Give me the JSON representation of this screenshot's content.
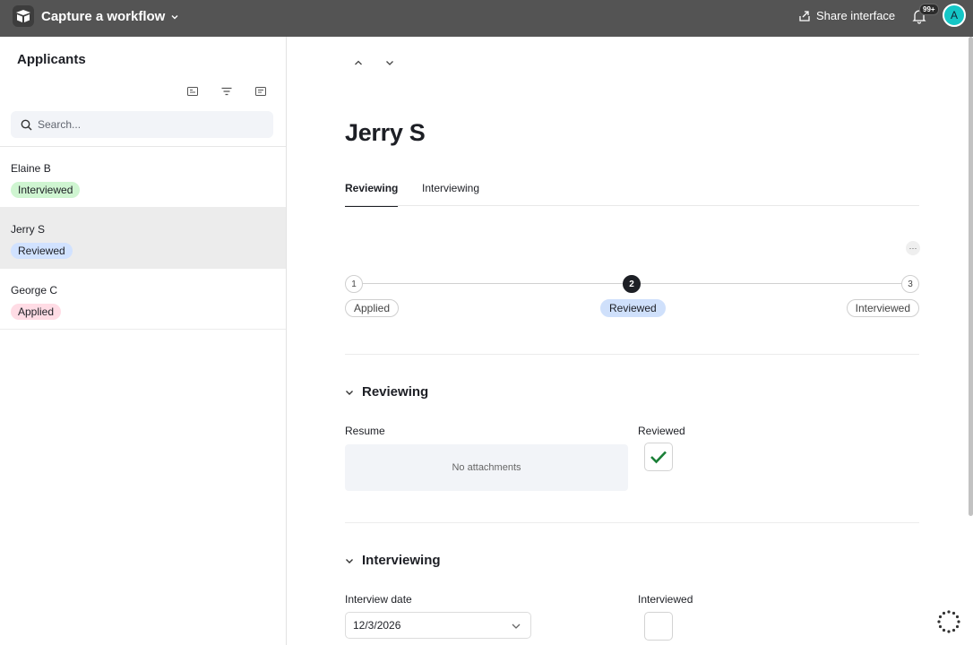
{
  "topbar": {
    "app_title": "Capture a workflow",
    "share_label": "Share interface",
    "notification_count": "99+",
    "avatar_initial": "A"
  },
  "sidebar": {
    "title": "Applicants",
    "search_placeholder": "Search...",
    "items": [
      {
        "name": "Elaine B",
        "status": "Interviewed",
        "status_color": "#cff5d1",
        "selected": false
      },
      {
        "name": "Jerry S",
        "status": "Reviewed",
        "status_color": "#d1e2ff",
        "selected": true
      },
      {
        "name": "George C",
        "status": "Applied",
        "status_color": "#ffdce5",
        "selected": false
      }
    ]
  },
  "record": {
    "title": "Jerry S",
    "tabs": [
      {
        "label": "Reviewing",
        "active": true
      },
      {
        "label": "Interviewing",
        "active": false
      }
    ],
    "more_label": "···",
    "steps": [
      {
        "number": "1",
        "label": "Applied",
        "active": false
      },
      {
        "number": "2",
        "label": "Reviewed",
        "active": true
      },
      {
        "number": "3",
        "label": "Interviewed",
        "active": false
      }
    ],
    "sections": {
      "reviewing": {
        "title": "Reviewing",
        "resume_label": "Resume",
        "resume_empty": "No attachments",
        "reviewed_label": "Reviewed",
        "reviewed_checked": true
      },
      "interviewing": {
        "title": "Interviewing",
        "interview_date_label": "Interview date",
        "interview_date_value": "12/3/2026",
        "interviewed_label": "Interviewed",
        "interviewed_checked": false
      }
    }
  },
  "colors": {
    "topbar": "#545454",
    "accent_check": "#1a7f37",
    "avatar": "#14c6c6"
  }
}
